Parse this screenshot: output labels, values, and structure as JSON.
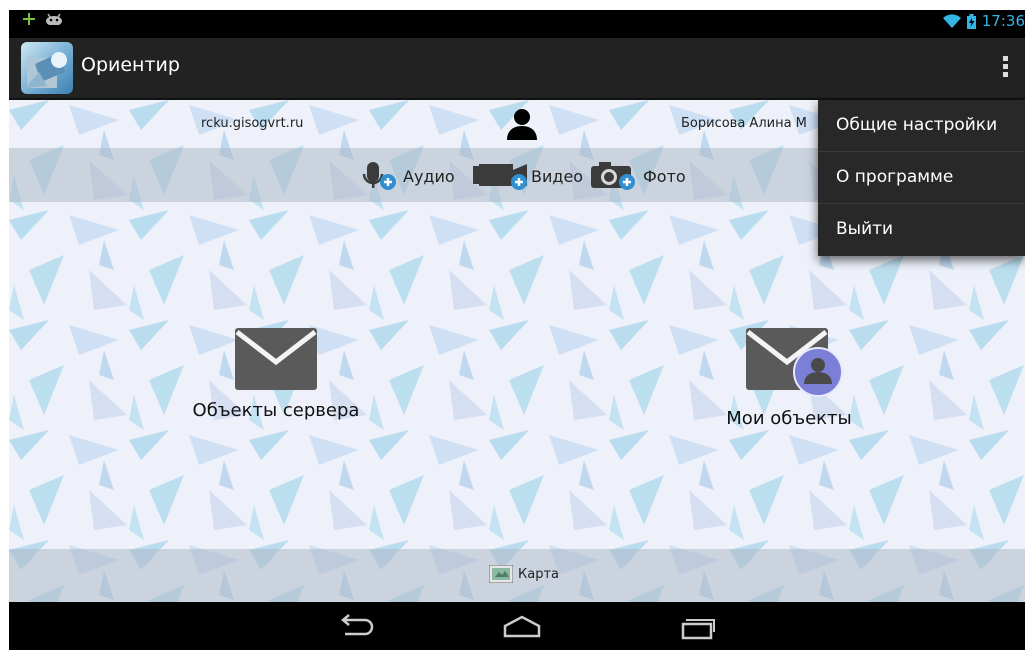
{
  "statusbar": {
    "time": "17:36",
    "icons": [
      "add-icon",
      "android-icon",
      "wifi-icon",
      "battery-icon"
    ]
  },
  "actionbar": {
    "title": "Ориентир",
    "overflow_icon": "overflow-menu-icon"
  },
  "header": {
    "server": "rcku.gisogvrt.ru",
    "user_name": "Борисова Алина М"
  },
  "media": {
    "audio": "Аудио",
    "video": "Видео",
    "photo": "Фото"
  },
  "tiles": {
    "server_objects": "Объекты сервера",
    "my_objects": "Мои объекты"
  },
  "bottom": {
    "map": "Карта"
  },
  "menu": {
    "items": [
      "Общие настройки",
      "О программе",
      "Выйти"
    ]
  },
  "colors": {
    "accent": "#33b5e5",
    "actionbar": "#222222",
    "menu_bg": "#282828",
    "badge": "#7b7fd6"
  }
}
